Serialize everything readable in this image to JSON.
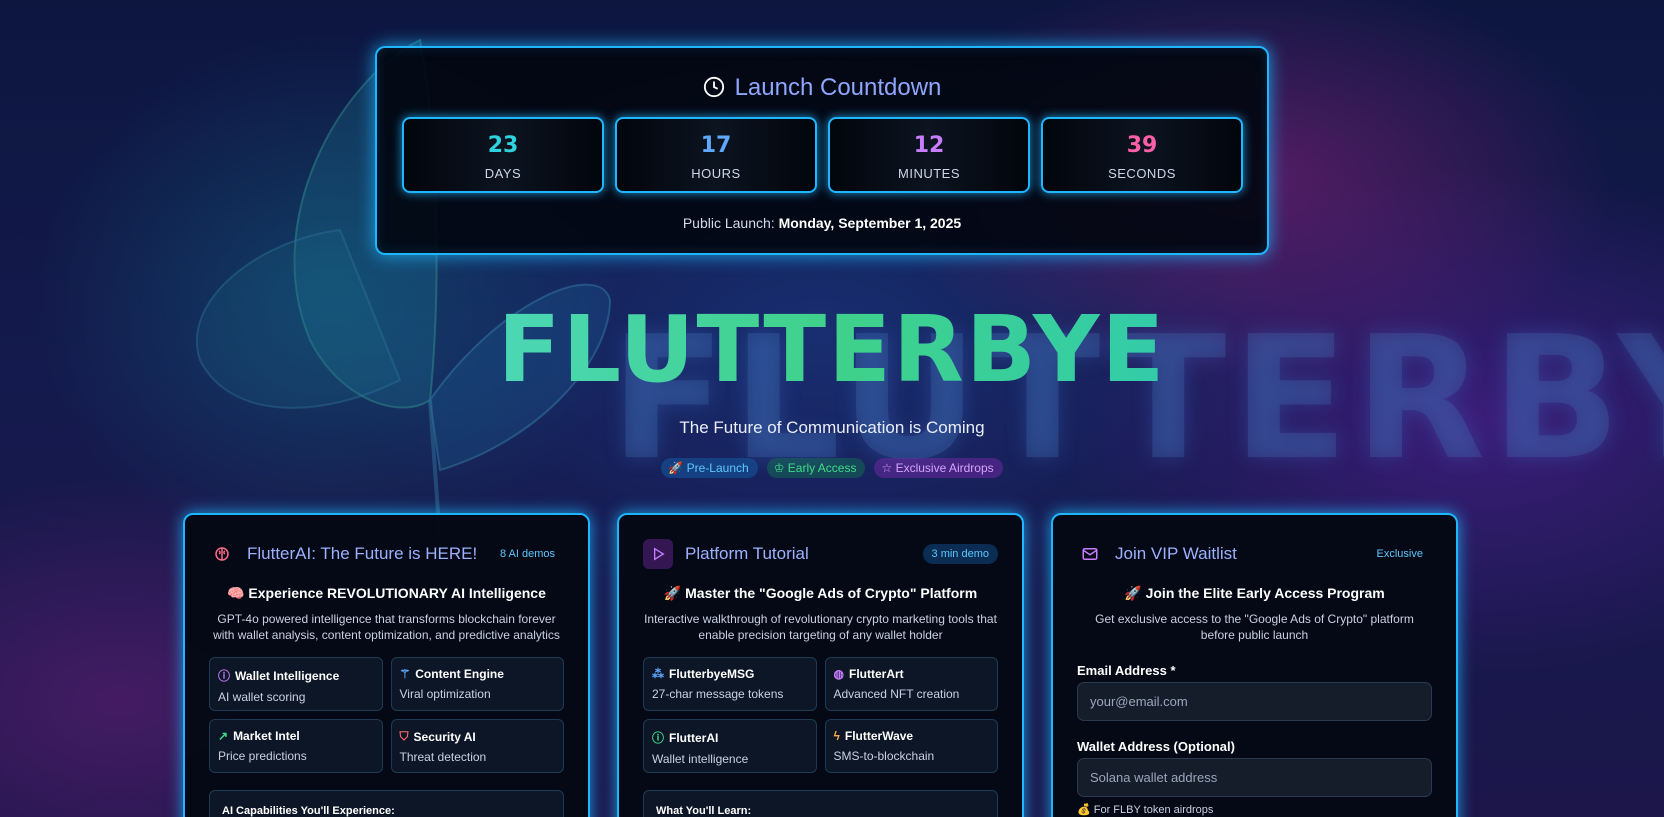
{
  "countdown": {
    "title": "Launch Countdown",
    "units": [
      {
        "value": "23",
        "label": "DAYS",
        "color": "#2fd3e0"
      },
      {
        "value": "17",
        "label": "HOURS",
        "color": "#5ea8ff"
      },
      {
        "value": "12",
        "label": "MINUTES",
        "color": "#c77dff"
      },
      {
        "value": "39",
        "label": "SECONDS",
        "color": "#ff5fa8"
      }
    ],
    "launch_prefix": "Public Launch:",
    "launch_date": "Monday, September 1, 2025"
  },
  "hero": {
    "title": "FLUTTERBYE",
    "subtitle": "The Future of Communication is Coming",
    "background_word": "FLUTTERBYE",
    "tags": [
      {
        "icon": "rocket-icon",
        "label": "Pre-Launch"
      },
      {
        "icon": "crown-icon",
        "label": "Early Access"
      },
      {
        "icon": "star-icon",
        "label": "Exclusive Airdrops"
      }
    ]
  },
  "ai_card": {
    "title": "FlutterAI: The Future is HERE!",
    "pill": "8 AI demos",
    "heading": "🧠 Experience REVOLUTIONARY AI Intelligence",
    "description": "GPT-4o powered intelligence that transforms blockchain forever with wallet analysis, content optimization, and predictive analytics",
    "features": [
      {
        "icon": "brain-icon",
        "title": "Wallet Intelligence",
        "subtitle": "AI wallet scoring",
        "color": "#c77dff"
      },
      {
        "icon": "wand-icon",
        "title": "Content Engine",
        "subtitle": "Viral optimization",
        "color": "#5ea8ff"
      },
      {
        "icon": "trend-icon",
        "title": "Market Intel",
        "subtitle": "Price predictions",
        "color": "#3fdc8a"
      },
      {
        "icon": "shield-icon",
        "title": "Security AI",
        "subtitle": "Threat detection",
        "color": "#ff6b6b"
      }
    ],
    "box_title": "AI Capabilities You'll Experience:"
  },
  "tutorial_card": {
    "title": "Platform Tutorial",
    "pill": "3 min demo",
    "heading": "🚀 Master the \"Google Ads of Crypto\" Platform",
    "description": "Interactive walkthrough of revolutionary crypto marketing tools that enable precision targeting of any wallet holder",
    "features": [
      {
        "icon": "message-icon",
        "title": "FlutterbyeMSG",
        "subtitle": "27-char message tokens",
        "color": "#5ea8ff"
      },
      {
        "icon": "palette-icon",
        "title": "FlutterArt",
        "subtitle": "Advanced NFT creation",
        "color": "#c77dff"
      },
      {
        "icon": "ai-icon",
        "title": "FlutterAI",
        "subtitle": "Wallet intelligence",
        "color": "#3fdc8a"
      },
      {
        "icon": "bolt-icon",
        "title": "FlutterWave",
        "subtitle": "SMS-to-blockchain",
        "color": "#ffa94d"
      }
    ],
    "box_title": "What You'll Learn:"
  },
  "waitlist_card": {
    "title": "Join VIP Waitlist",
    "pill": "Exclusive",
    "heading": "🚀 Join the Elite Early Access Program",
    "description": "Get exclusive access to the \"Google Ads of Crypto\" platform before public launch",
    "email_label": "Email Address *",
    "email_placeholder": "your@email.com",
    "wallet_label": "Wallet Address (Optional)",
    "wallet_placeholder": "Solana wallet address",
    "hint": "💰 For FLBY token airdrops"
  }
}
